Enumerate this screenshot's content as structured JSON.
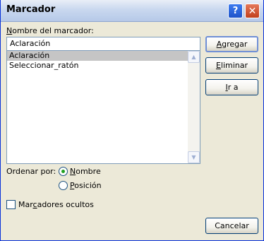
{
  "window": {
    "title": "Marcador",
    "help_symbol": "?",
    "close_symbol": "✕"
  },
  "bookmark_name": {
    "label_prefix": "N",
    "label_rest": "ombre del marcador:",
    "value": "Aclaración"
  },
  "bookmarks_list": {
    "items": [
      {
        "label": "Aclaración",
        "selected": true
      },
      {
        "label": "Seleccionar_ratón",
        "selected": false
      }
    ],
    "scroll_up_symbol": "▲",
    "scroll_down_symbol": "▼"
  },
  "buttons": {
    "add": {
      "mnemonic": "A",
      "rest": "gregar"
    },
    "delete": {
      "mnemonic": "E",
      "rest": "liminar"
    },
    "goto": {
      "mnemonic": "I",
      "rest": "r a"
    },
    "cancel": {
      "label": "Cancelar"
    }
  },
  "sort": {
    "label": "Ordenar por:",
    "options": [
      {
        "mnemonic": "N",
        "rest": "ombre",
        "selected": true
      },
      {
        "mnemonic": "P",
        "rest": "osición",
        "selected": false
      }
    ]
  },
  "hidden_bookmarks": {
    "pre": "Mar",
    "mnemonic": "c",
    "post": "adores ocultos",
    "checked": false
  },
  "colors": {
    "dialog_background": "#ece9d8",
    "list_selection": "#c5c5c5",
    "radio_selected": "#21a121",
    "titlebar": "#c9d8ef"
  }
}
